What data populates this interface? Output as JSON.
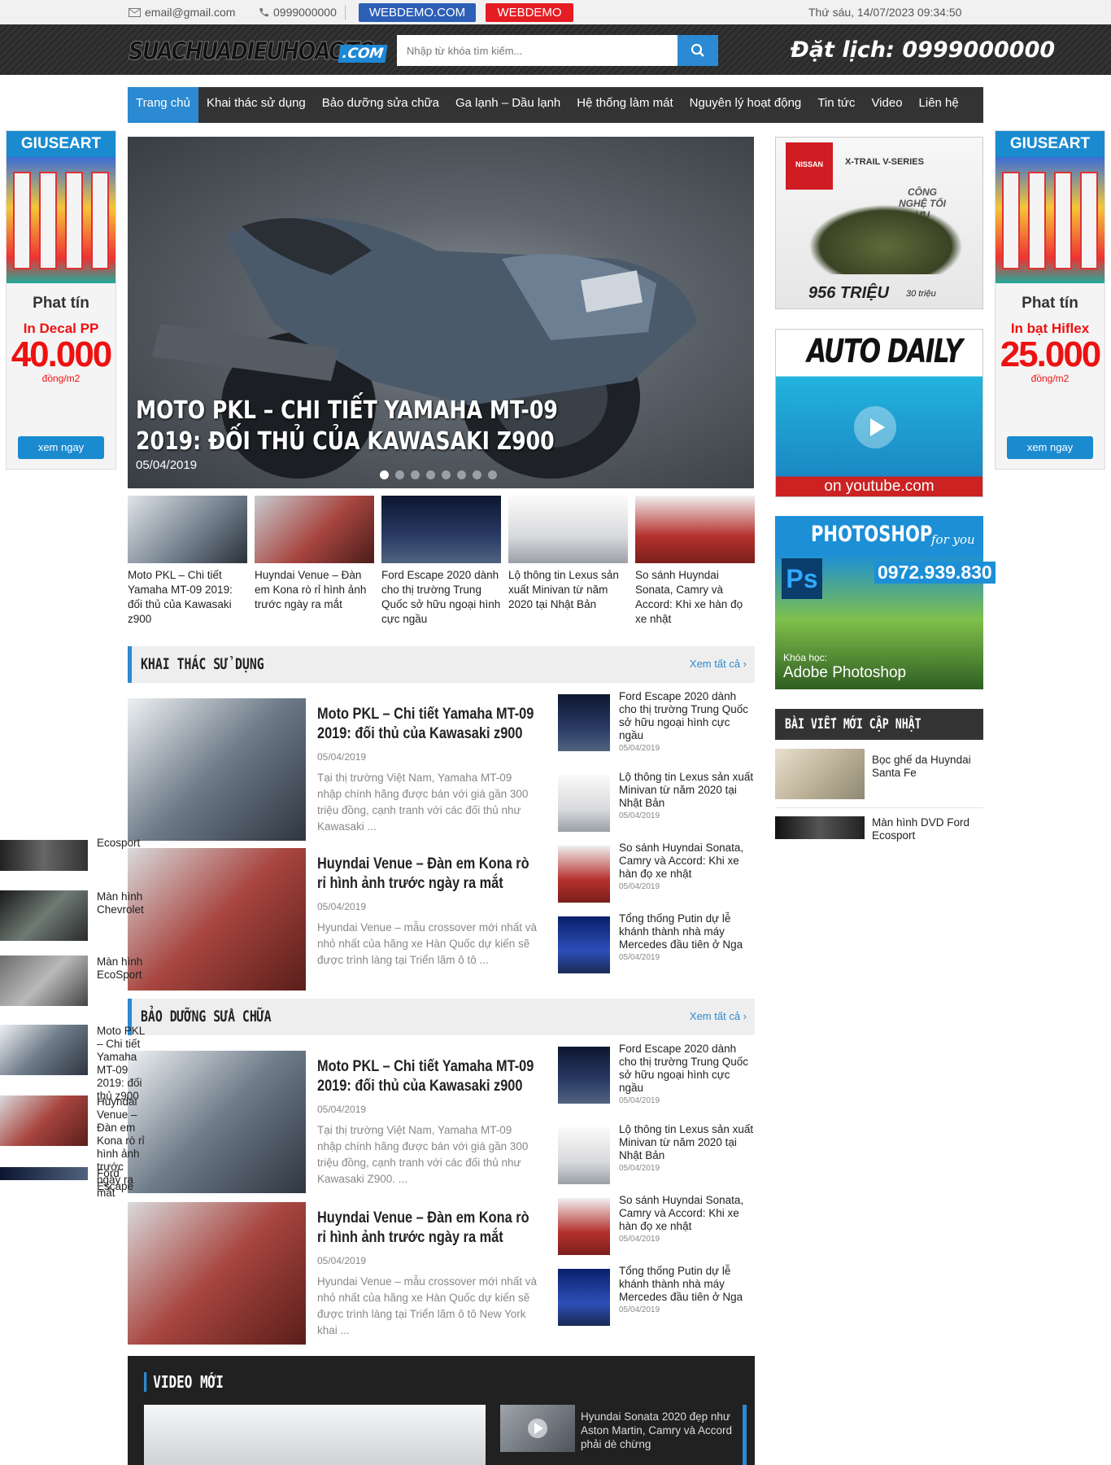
{
  "topbar": {
    "email": "email@gmail.com",
    "phone": "0999000000",
    "badge1": "WEBDEMO.COM",
    "badge2": "WEBDEMO",
    "datetime": "Thứ sáu, 14/07/2023 09:34:50"
  },
  "header": {
    "logo_text": "SUACHUADIEUHOAOTO",
    "logo_suffix": ".COM",
    "search_placeholder": "Nhập từ khóa tìm kiếm...",
    "hotline": "Đặt lịch: 0999000000"
  },
  "nav": {
    "items": [
      "Trang chủ",
      "Khai thác sử dụng",
      "Bảo dưỡng sửa chữa",
      "Ga lạnh – Dầu lạnh",
      "Hệ thống làm mát",
      "Nguyên lý hoạt động",
      "Tin tức",
      "Video",
      "Liên hệ"
    ]
  },
  "side_ads": {
    "left": {
      "header": "GIUSEART",
      "brand": "Phat tín",
      "line1": "In Decal PP",
      "price": "40.000",
      "unit": "đồng/m2",
      "button": "xem ngay"
    },
    "right": {
      "header": "GIUSEART",
      "brand": "Phat tín",
      "line1": "In bạt Hiflex",
      "price": "25.000",
      "unit": "đồng/m2",
      "button": "xem ngay"
    }
  },
  "slider": {
    "caption": "Moto PKL – Chi tiết Yamaha MT-09 2019: đối thủ của Kawasaki z900",
    "date": "05/04/2019",
    "slide_count": 8,
    "active_slide": 1
  },
  "thumbs": [
    {
      "title": "Moto PKL – Chi tiết Yamaha MT-09 2019: đối thủ của Kawasaki z900",
      "color": "#6d7a88"
    },
    {
      "title": "Huyndai Venue – Đàn em Kona rò rỉ hình ảnh trước ngày ra mắt",
      "color": "#a8453f"
    },
    {
      "title": "Ford Escape 2020 dành cho thị trường Trung Quốc sở hữu ngoại hình cực ngầu",
      "color": "#2a3b66"
    },
    {
      "title": "Lộ thông tin Lexus sản xuất Minivan từ năm 2020 tại Nhật Bản",
      "color": "#d9dadc"
    },
    {
      "title": "So sánh Huyndai Sonata, Camry và Accord: Khi xe hàn đọ xe nhật",
      "color": "#b5312d"
    }
  ],
  "sections": [
    {
      "title": "KHAI THÁC SỬ DỤNG",
      "more": "Xem tất cả",
      "big": [
        {
          "title": "Moto PKL – Chi tiết Yamaha MT-09 2019: đối thủ của Kawasaki z900",
          "date": "05/04/2019",
          "excerpt": "Tại thị trường Việt Nam, Yamaha MT-09 nhập chính hãng được bán với giá gần 300 triệu đồng, cạnh tranh với các đối thủ như Kawasaki ..."
        },
        {
          "title": "Huyndai Venue – Đàn em Kona rò rỉ hình ảnh trước ngày ra mắt",
          "date": "05/04/2019",
          "excerpt": "Hyundai Venue – mẫu crossover mới nhất và nhỏ nhất của hãng xe Hàn Quốc dự kiến sẽ được trình làng tại Triển lãm ô tô ..."
        }
      ],
      "small": [
        {
          "title": "Ford Escape 2020 dành cho thị trường Trung Quốc sở hữu ngoại hình cực ngầu",
          "date": "05/04/2019"
        },
        {
          "title": "Lộ thông tin Lexus sản xuất Minivan từ năm 2020 tại Nhật Bản",
          "date": "05/04/2019"
        },
        {
          "title": "So sánh Huyndai Sonata, Camry và Accord: Khi xe hàn đọ xe nhật",
          "date": "05/04/2019"
        },
        {
          "title": "Tổng thống Putin dự lễ khánh thành nhà máy Mercedes đầu tiên ở Nga",
          "date": "05/04/2019"
        }
      ]
    },
    {
      "title": "BẢO DƯỠNG SỬA CHỮA",
      "more": "Xem tất cả",
      "big": [
        {
          "title": "Moto PKL – Chi tiết Yamaha MT-09 2019: đối thủ của Kawasaki z900",
          "date": "05/04/2019",
          "excerpt": "Tại thị trường Việt Nam, Yamaha MT-09 nhập chính hãng được bán với giá gần 300 triệu đồng, cạnh tranh với các đối thủ như Kawasaki Z900. ..."
        },
        {
          "title": "Huyndai Venue – Đàn em Kona rò rỉ hình ảnh trước ngày ra mắt",
          "date": "05/04/2019",
          "excerpt": "Hyundai Venue – mẫu crossover mới nhất và nhỏ nhất của hãng xe Hàn Quốc dự kiến sẽ được trình làng tại Triển lãm ô tô New York khai ..."
        }
      ],
      "small": [
        {
          "title": "Ford Escape 2020 dành cho thị trường Trung Quốc sở hữu ngoại hình cực ngầu",
          "date": "05/04/2019"
        },
        {
          "title": "Lộ thông tin Lexus sản xuất Minivan từ năm 2020 tại Nhật Bản",
          "date": "05/04/2019"
        },
        {
          "title": "So sánh Huyndai Sonata, Camry và Accord: Khi xe hàn đọ xe nhật",
          "date": "05/04/2019"
        },
        {
          "title": "Tổng thống Putin dự lễ khánh thành nhà máy Mercedes đầu tiên ở Nga",
          "date": "05/04/2019"
        }
      ]
    }
  ],
  "right_ads": {
    "nissan": {
      "brand": "NISSAN",
      "model": "X-TRAIL V-SERIES",
      "tag": "CÔNG NGHỆ TỐI ƯU",
      "price": "956 TRIỆU",
      "note": "30 triệu"
    },
    "autodaily": {
      "title": "AUTO DAILY",
      "footer": "on youtube.com"
    },
    "photoshop": {
      "title": "PHOTOSHOP",
      "sub": "for you",
      "phone": "0972.939.830",
      "ps": "Ps",
      "course_label": "Khóa học:",
      "course": "Adobe Photoshop"
    }
  },
  "widget": {
    "title": "BÀI VIẾT MỚI CẬP NHẬT",
    "items": [
      "Bọc ghế da Huyndai Santa Fe",
      "Màn hình DVD Ford Ecosport"
    ]
  },
  "floating": {
    "items": [
      "Ecosport",
      "Màn hình Chevrolet",
      "Màn hình EcoSport",
      "Moto PKL – Chi tiết Yamaha MT-09 2019: đối thủ z900",
      "Huyndai Venue – Đàn em Kona rò rỉ hình ảnh trước ngày ra mắt",
      "Ford Escape"
    ]
  },
  "video": {
    "title": "VIDEO MỚI",
    "item": "Hyundai Sonata 2020 đẹp như Aston Martin, Camry và Accord phải dè chừng"
  },
  "colors": {
    "accent": "#2b8ad1",
    "nav_bg": "#333333",
    "badge_red": "#e51c23",
    "badge_blue": "#2d5fb6"
  }
}
